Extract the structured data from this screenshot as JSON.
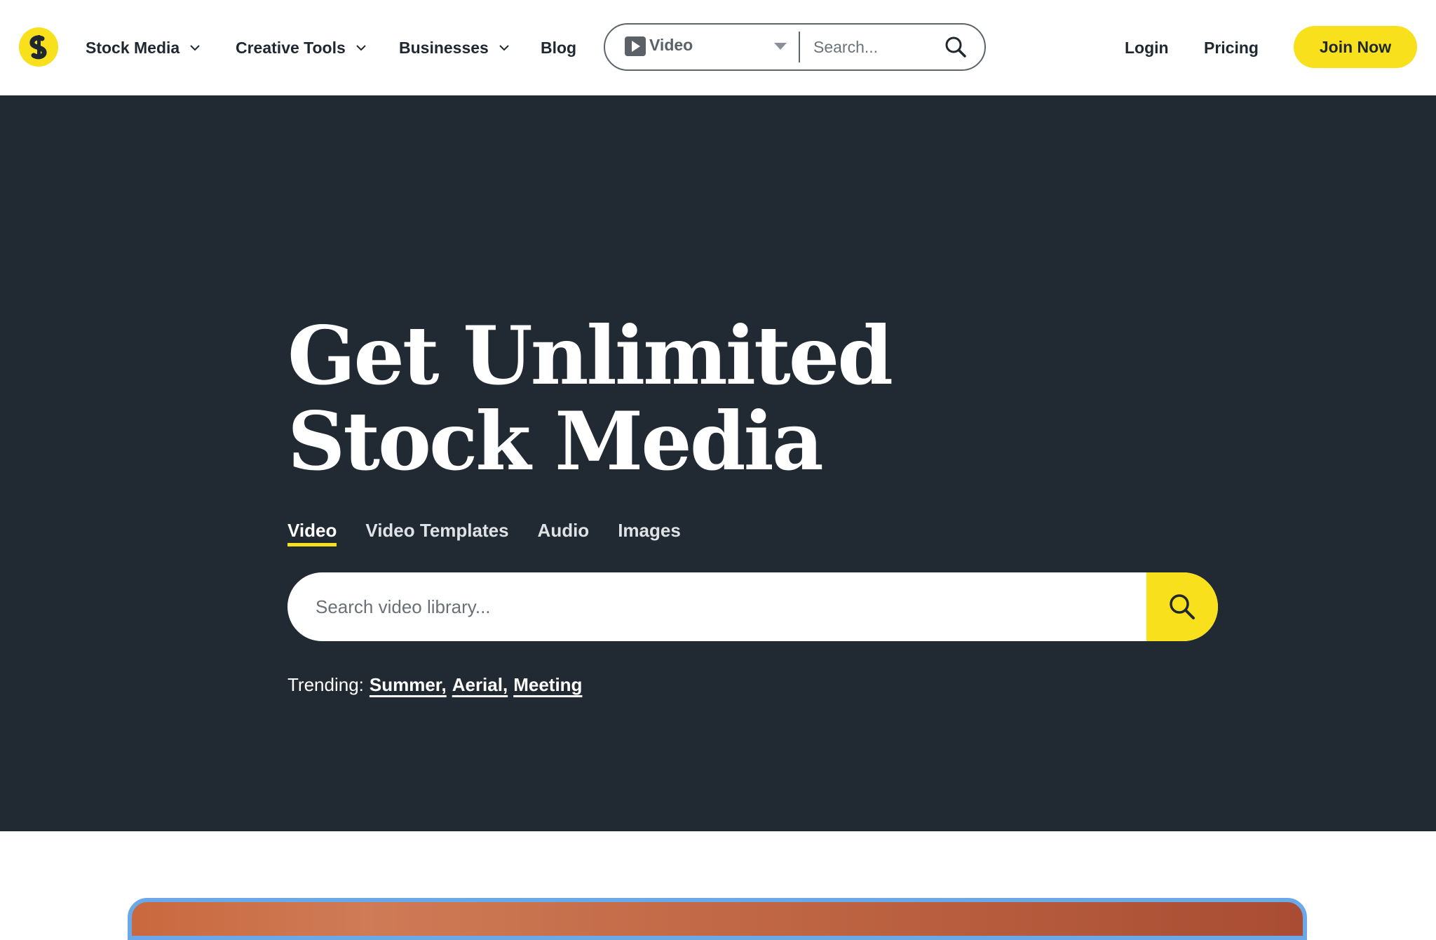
{
  "brand": {
    "logo_letter": "S",
    "accent_color": "#f8e01d",
    "dark_bg": "#212932"
  },
  "nav": {
    "items": [
      {
        "label": "Stock Media",
        "has_dropdown": true
      },
      {
        "label": "Creative Tools",
        "has_dropdown": true
      },
      {
        "label": "Businesses",
        "has_dropdown": true
      },
      {
        "label": "Blog",
        "has_dropdown": false
      }
    ],
    "search": {
      "type_label": "Video",
      "type_icon": "play-icon",
      "placeholder": "Search..."
    },
    "login_label": "Login",
    "pricing_label": "Pricing",
    "join_label": "Join Now"
  },
  "hero": {
    "title_line1": "Get Unlimited",
    "title_line2": "Stock Media",
    "tabs": [
      {
        "label": "Video",
        "active": true
      },
      {
        "label": "Video Templates",
        "active": false
      },
      {
        "label": "Audio",
        "active": false
      },
      {
        "label": "Images",
        "active": false
      }
    ],
    "search_placeholder": "Search video library...",
    "trending_label": "Trending:",
    "trending_terms": [
      "Summer,",
      "Aerial,",
      "Meeting"
    ]
  }
}
